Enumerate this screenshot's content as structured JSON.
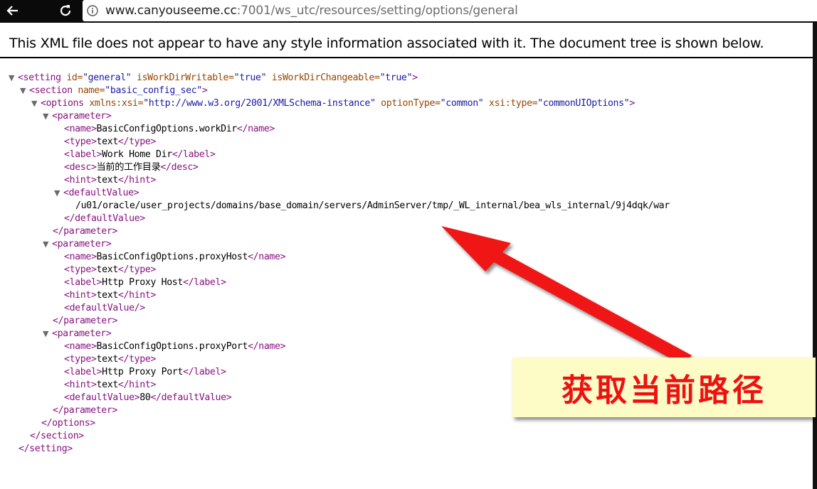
{
  "browser": {
    "url_host": "www.canyouseeme.cc",
    "url_rest": ":7001/ws_utc/resources/setting/options/general"
  },
  "notice": "This XML file does not appear to have any style information associated with it. The document tree is shown below.",
  "xml": {
    "l1_attr1_name": "id=",
    "l1_attr1_val": "\"general\"",
    "l1_attr2_name": "isWorkDirWritable=",
    "l1_attr2_val": "\"true\"",
    "l1_attr3_name": "isWorkDirChangeable=",
    "l1_attr3_val": "\"true\"",
    "l2_attr_name": "name=",
    "l2_attr_val": "\"basic_config_sec\"",
    "l3_attr1_name": "xmlns:xsi=",
    "l3_attr1_val": "\"http://www.w3.org/2001/XMLSchema-instance\"",
    "l3_attr2_name": "optionType=",
    "l3_attr2_val": "\"common\"",
    "l3_attr3_name": "xsi:type=",
    "l3_attr3_val": "\"commonUIOptions\"",
    "p1_name": "BasicConfigOptions.workDir",
    "p1_type": "text",
    "p1_label": "Work Home Dir",
    "p1_desc": "当前的工作目录",
    "p1_hint": "text",
    "p1_default": "/u01/oracle/user_projects/domains/base_domain/servers/AdminServer/tmp/_WL_internal/bea_wls_internal/9j4dqk/war",
    "p2_name": "BasicConfigOptions.proxyHost",
    "p2_type": "text",
    "p2_label": "Http Proxy Host",
    "p2_hint": "text",
    "p3_name": "BasicConfigOptions.proxyPort",
    "p3_type": "text",
    "p3_label": "Http Proxy Port",
    "p3_hint": "text",
    "p3_default": "80"
  },
  "callout": {
    "text": "获取当前路径",
    "color": "#ee1111"
  },
  "icons": {
    "back": "back-arrow-icon",
    "reload": "reload-icon",
    "info": "info-icon",
    "toggle": "collapse-triangle-icon"
  }
}
